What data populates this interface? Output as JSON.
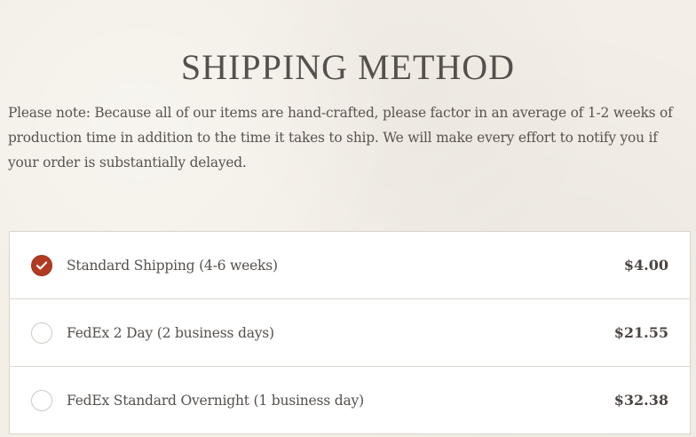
{
  "title": "SHIPPING METHOD",
  "note": "Please note: Because all of our items are hand-crafted, please factor in an average of 1-2 weeks of production time in addition to the time it takes to ship. We will make every effort to notify you if your order is substantially delayed.",
  "accent_color": "#b33a22",
  "shipping_options": [
    {
      "label": "Standard Shipping (4-6 weeks)",
      "price": "$4.00",
      "selected": true
    },
    {
      "label": "FedEx 2 Day (2 business days)",
      "price": "$21.55",
      "selected": false
    },
    {
      "label": "FedEx Standard Overnight (1 business day)",
      "price": "$32.38",
      "selected": false
    }
  ]
}
